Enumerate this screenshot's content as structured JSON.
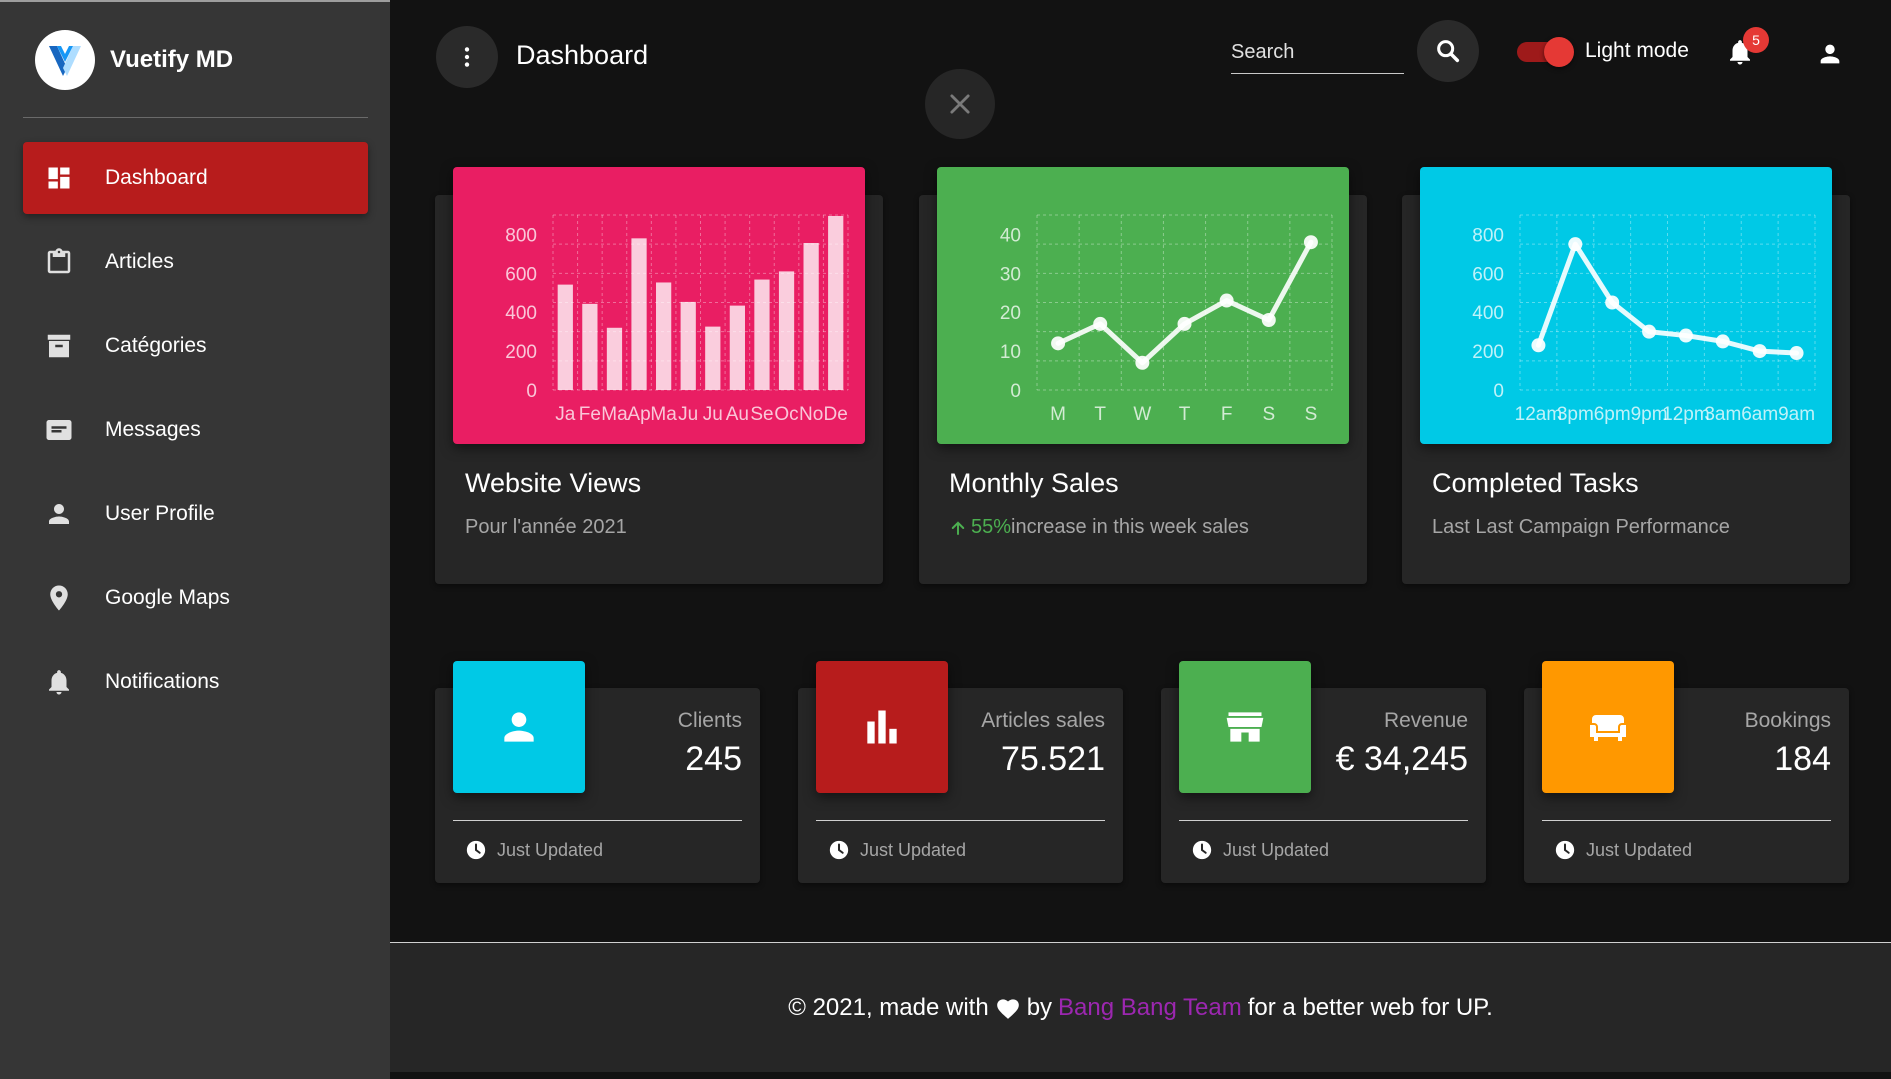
{
  "brand": {
    "title": "Vuetify MD",
    "logo_icon": "vuetify-logo-icon"
  },
  "sidebar": {
    "items": [
      {
        "label": "Dashboard",
        "icon": "dashboard-icon",
        "active": true
      },
      {
        "label": "Articles",
        "icon": "clipboard-icon",
        "active": false
      },
      {
        "label": "Catégories",
        "icon": "archive-icon",
        "active": false
      },
      {
        "label": "Messages",
        "icon": "message-icon",
        "active": false
      },
      {
        "label": "User Profile",
        "icon": "person-icon",
        "active": false
      },
      {
        "label": "Google Maps",
        "icon": "map-marker-icon",
        "active": false
      },
      {
        "label": "Notifications",
        "icon": "bell-icon",
        "active": false
      }
    ]
  },
  "appbar": {
    "title": "Dashboard",
    "search_placeholder": "Search",
    "toggle_label": "Light mode",
    "notification_count": "5"
  },
  "cards": [
    {
      "title": "Website Views",
      "subtitle": "Pour l'année 2021",
      "color": "#e91e63"
    },
    {
      "title": "Monthly Sales",
      "subtitle_highlight": "55%",
      "subtitle": "increase in this week sales",
      "color": "#4caf50"
    },
    {
      "title": "Completed Tasks",
      "subtitle": "Last Last Campaign Performance",
      "color": "#00c9e6"
    }
  ],
  "chart_data": [
    {
      "type": "bar",
      "categories": [
        "Ja",
        "Fe",
        "Ma",
        "Ap",
        "Ma",
        "Ju",
        "Ju",
        "Au",
        "Se",
        "Oc",
        "No",
        "De"
      ],
      "values": [
        542,
        443,
        320,
        780,
        553,
        453,
        326,
        434,
        568,
        610,
        756,
        895
      ],
      "yticks": [
        "0",
        "200",
        "400",
        "600",
        "800"
      ],
      "ylim": [
        0,
        900
      ],
      "grid": true
    },
    {
      "type": "line",
      "categories": [
        "M",
        "T",
        "W",
        "T",
        "F",
        "S",
        "S"
      ],
      "values": [
        12,
        17,
        7,
        17,
        23,
        18,
        38
      ],
      "yticks": [
        "0",
        "10",
        "20",
        "30",
        "40"
      ],
      "ylim": [
        0,
        45
      ],
      "grid": true
    },
    {
      "type": "line",
      "categories": [
        "12am",
        "3pm",
        "6pm",
        "9pm",
        "12pm",
        "3am",
        "6am",
        "9am"
      ],
      "values": [
        230,
        750,
        450,
        300,
        280,
        250,
        200,
        190
      ],
      "yticks": [
        "0",
        "200",
        "400",
        "600",
        "800"
      ],
      "ylim": [
        0,
        900
      ],
      "grid": true
    }
  ],
  "stats": [
    {
      "label": "Clients",
      "value": "245",
      "foot": "Just Updated",
      "icon": "account-icon",
      "color": "#00c9e6"
    },
    {
      "label": "Articles sales",
      "value": "75.521",
      "foot": "Just Updated",
      "icon": "bar-chart-icon",
      "color": "#b71c1c"
    },
    {
      "label": "Revenue",
      "value": "€ 34,245",
      "foot": "Just Updated",
      "icon": "store-icon",
      "color": "#4caf50"
    },
    {
      "label": "Bookings",
      "value": "184",
      "foot": "Just Updated",
      "icon": "sofa-icon",
      "color": "#ff9800"
    }
  ],
  "footer": {
    "prefix": "© 2021, made with",
    "by": "by",
    "team": "Bang Bang Team",
    "suffix": "for a better web for UP."
  }
}
